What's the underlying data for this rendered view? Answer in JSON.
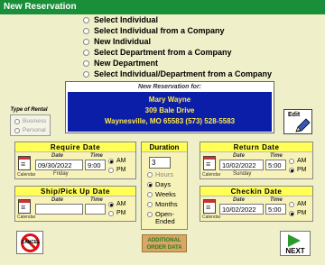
{
  "window": {
    "title": "New Reservation"
  },
  "options": [
    {
      "label": "Select Individual"
    },
    {
      "label": "Select Individual from a Company"
    },
    {
      "label": "New Individual"
    },
    {
      "label": "Select Department from a Company"
    },
    {
      "label": "New Department"
    },
    {
      "label": "Select Individual/Department from a Company"
    }
  ],
  "reservation": {
    "header": "New Reservation for:",
    "name": "Mary  Wayne",
    "address": "309 Bale Drive",
    "city_line": "Waynesville, MO  65583    (573) 528-5583"
  },
  "type_of_rental": {
    "label": "Type of Rental",
    "options": [
      "Business",
      "Personal"
    ]
  },
  "edit_label": "Edit",
  "require": {
    "title": "Require Date",
    "date_label": "Date",
    "time_label": "Time",
    "date": "09/30/2022",
    "time": "9:00",
    "day": "Friday",
    "am": "AM",
    "pm": "PM",
    "selected": "AM"
  },
  "ship": {
    "title": "Ship/Pick Up Date",
    "date_label": "Date",
    "time_label": "Time",
    "date": "",
    "time": "",
    "am": "AM",
    "pm": "PM",
    "selected": "AM"
  },
  "return": {
    "title": "Return Date",
    "date_label": "Date",
    "time_label": "Time",
    "date": "10/02/2022",
    "time": "5:00",
    "day": "Sunday",
    "am": "AM",
    "pm": "PM",
    "selected": "PM"
  },
  "checkin": {
    "title": "Checkin Date",
    "date_label": "Date",
    "time_label": "Time",
    "date": "10/02/2022",
    "time": "5:00",
    "am": "AM",
    "pm": "PM",
    "selected": "PM"
  },
  "calendar_label": "Calendar",
  "duration": {
    "title": "Duration",
    "value": "3",
    "options": [
      "Hours",
      "Days",
      "Weeks",
      "Months",
      "Open-\nEnded"
    ],
    "selected": "Days"
  },
  "buttons": {
    "cancel": "CANCEL",
    "additional": "ADDITIONAL\nORDER DATA",
    "next": "NEXT"
  },
  "colors": {
    "titlebar": "#1a8f3a",
    "panel_header": "#ffff55",
    "reservation_bg": "#0a1ea8",
    "reservation_text": "#ffe84a"
  }
}
